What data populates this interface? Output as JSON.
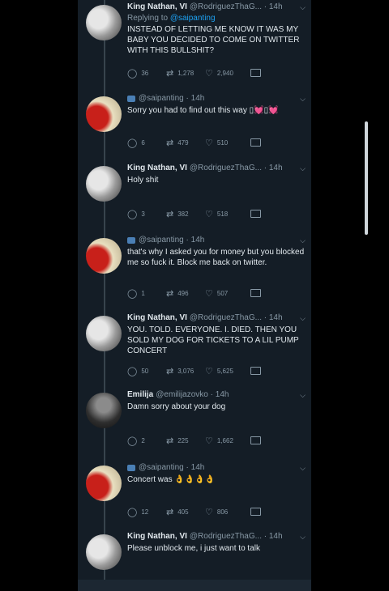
{
  "tweets": [
    {
      "name": "King Nathan, VI",
      "handle": "@RodriguezThaG...",
      "time": "14h",
      "replying_prefix": "Replying to",
      "replying_to": "@saipanting",
      "text": "INSTEAD OF LETTING ME KNOW IT WAS MY BABY YOU DECIDED TO COME ON TWITTER WITH THIS BULLSHIT?",
      "replies": "36",
      "retweets": "1,278",
      "likes": "2,940"
    },
    {
      "name": "",
      "handle": "@saipanting",
      "time": "14h",
      "text": "Sorry you had to find out this way ▯💓▯💓",
      "replies": "6",
      "retweets": "479",
      "likes": "510"
    },
    {
      "name": "King Nathan, VI",
      "handle": "@RodriguezThaG...",
      "time": "14h",
      "text": "Holy shit",
      "replies": "3",
      "retweets": "382",
      "likes": "518"
    },
    {
      "name": "",
      "handle": "@saipanting",
      "time": "14h",
      "text": "that's why I asked you for money but you blocked me so fuck it. Block me back on twitter.",
      "replies": "1",
      "retweets": "496",
      "likes": "507"
    },
    {
      "name": "King Nathan, VI",
      "handle": "@RodriguezThaG...",
      "time": "14h",
      "text": "YOU. TOLD. EVERYONE. I. DIED. THEN YOU SOLD MY DOG FOR TICKETS TO A LIL PUMP CONCERT",
      "replies": "50",
      "retweets": "3,076",
      "likes": "5,625"
    },
    {
      "name": "Emilija",
      "handle": "@emilijazovko",
      "time": "14h",
      "text": "Damn sorry about your dog",
      "replies": "2",
      "retweets": "225",
      "likes": "1,662"
    },
    {
      "name": "",
      "handle": "@saipanting",
      "time": "14h",
      "text": "Concert was 👌👌👌👌",
      "replies": "12",
      "retweets": "405",
      "likes": "806"
    },
    {
      "name": "King Nathan, VI",
      "handle": "@RodriguezThaG...",
      "time": "14h",
      "text": "Please unblock me, i just want to talk"
    }
  ],
  "colors": {
    "background": "#141d26",
    "text": "#e1e8ed",
    "muted": "#8899a6",
    "link": "#1da1f2"
  },
  "icons": {
    "reply": "reply-icon",
    "retweet": "retweet-icon",
    "like": "heart-icon",
    "dm": "envelope-icon",
    "menu": "chevron-down-icon"
  }
}
